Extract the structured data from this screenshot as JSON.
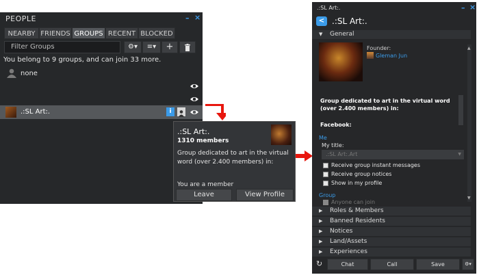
{
  "people": {
    "title": "PEOPLE",
    "window_controls": {
      "minimize": "–",
      "close": "×"
    },
    "tabs": [
      {
        "label": "NEARBY",
        "active": false
      },
      {
        "label": "FRIENDS",
        "active": false
      },
      {
        "label": "GROUPS",
        "active": true
      },
      {
        "label": "RECENT",
        "active": false
      },
      {
        "label": "BLOCKED",
        "active": false
      }
    ],
    "filter_placeholder": "Filter Groups",
    "toolbar": {
      "gear": "⚙▾",
      "sort": "≡▾",
      "add": "+",
      "trash": "🗑"
    },
    "info": "You belong to 9 groups, and can join 33 more.",
    "none_label": "none",
    "group_row_name": ".:SL Art:."
  },
  "tooltip": {
    "title": ".:SL Art:.",
    "members": "1310 members",
    "description": "Group dedicated to art in the virtual word (over 2.400 members) in:",
    "status": "You are a member",
    "leave": "Leave",
    "view_profile": "View Profile"
  },
  "group_profile": {
    "window_title": ".:SL Art:.",
    "window_controls": {
      "minimize": "–",
      "close": "×"
    },
    "back": "<",
    "title": ".:SL Art:.",
    "general_label": "General",
    "founder_label": "Founder:",
    "founder_name": "Gleman Jun",
    "description": "Group dedicated to art in the virtual word (over 2.400 members) in:",
    "facebook_label": "Facebook:",
    "me_label": "Me",
    "my_title_label": "My title:",
    "my_title_value": ".:SL Art:.Art",
    "checkboxes": [
      {
        "label": "Receive group instant messages",
        "checked": true
      },
      {
        "label": "Receive group notices",
        "checked": true
      },
      {
        "label": "Show in my profile",
        "checked": true
      }
    ],
    "group_label": "Group",
    "anyone_can_join": "Anyone can join",
    "sections": [
      "Roles & Members",
      "Banned Residents",
      "Notices",
      "Land/Assets",
      "Experiences"
    ],
    "buttons": {
      "refresh": "↻",
      "chat": "Chat",
      "call": "Call",
      "save": "Save",
      "gear": "⚙▾"
    }
  },
  "colors": {
    "accent": "#3b9be8",
    "arrow": "#e8170e",
    "panel": "#262729"
  }
}
